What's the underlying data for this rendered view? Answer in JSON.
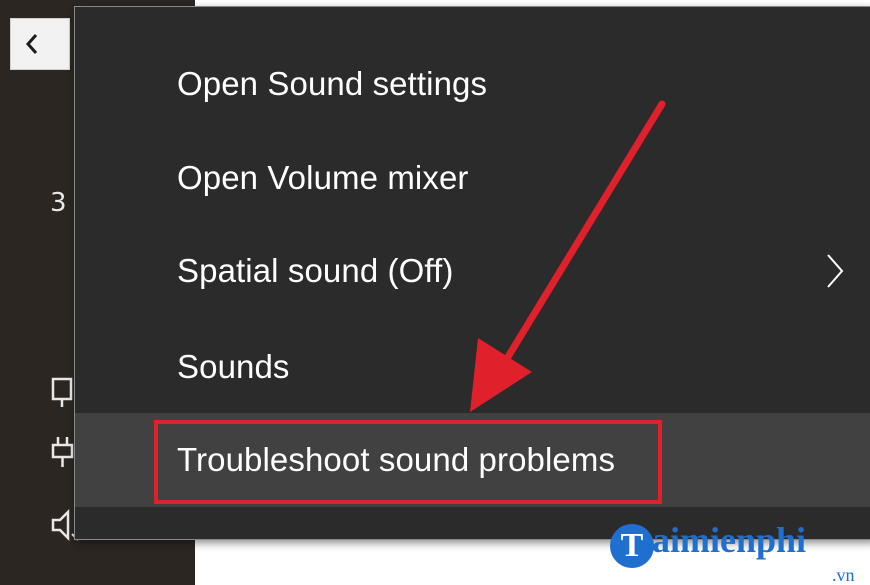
{
  "left_panel": {
    "glyphs": [
      "3",
      "⌂",
      "☷",
      "🔈"
    ]
  },
  "context_menu": {
    "items": [
      {
        "label": "Open Sound settings",
        "has_submenu": false,
        "hovered": false
      },
      {
        "label": "Open Volume mixer",
        "has_submenu": false,
        "hovered": false
      },
      {
        "label": "Spatial sound (Off)",
        "has_submenu": true,
        "hovered": false
      },
      {
        "label": "Sounds",
        "has_submenu": false,
        "hovered": false
      },
      {
        "label": "Troubleshoot sound problems",
        "has_submenu": false,
        "hovered": true
      }
    ]
  },
  "annotation": {
    "highlight_color": "#e0202a",
    "arrow_color": "#e0202a",
    "highlight_target": "Troubleshoot sound problems"
  },
  "watermark": {
    "badge": "T",
    "text": "aimienphi",
    "suffix": ".vn",
    "color": "#1f6fd0"
  },
  "colors": {
    "menu_background": "#2b2b2b",
    "menu_hover": "#414141",
    "menu_text": "#ffffff",
    "taskbar": "#2b2622"
  }
}
